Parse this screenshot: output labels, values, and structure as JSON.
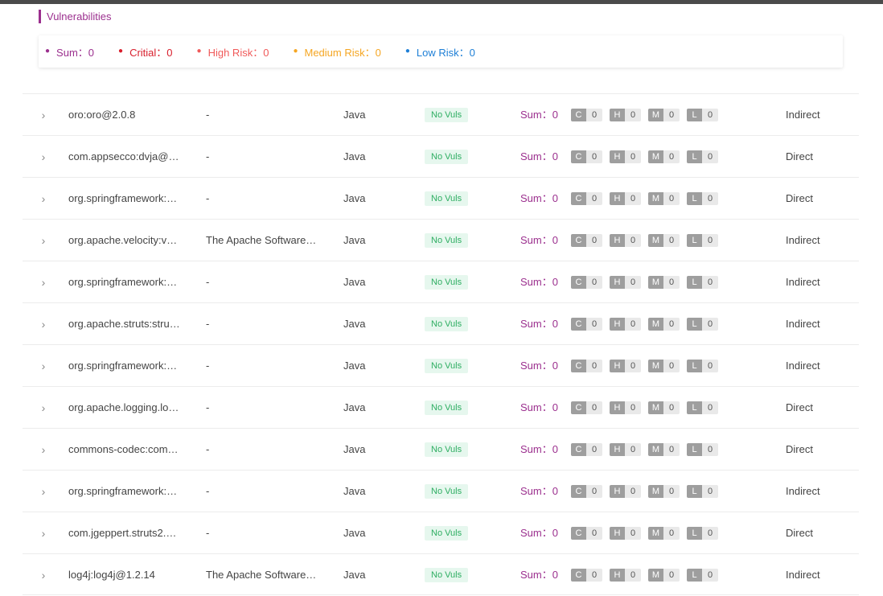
{
  "section_title": "Vulnerabilities",
  "summary": [
    {
      "label": "Sum：0",
      "color": "#9b2f8e"
    },
    {
      "label": "Critial：0",
      "color": "#d81e2c"
    },
    {
      "label": "High Risk：0",
      "color": "#f05a5a"
    },
    {
      "label": "Medium Risk：0",
      "color": "#f5a623"
    },
    {
      "label": "Low Risk：0",
      "color": "#1e7fd6"
    }
  ],
  "level_keys": [
    "C",
    "H",
    "M",
    "L"
  ],
  "rows": [
    {
      "name": "oro:oro@2.0.8",
      "vendor": "-",
      "language": "Java",
      "status": "No Vuls",
      "sum": "Sum：0",
      "counts": [
        "0",
        "0",
        "0",
        "0"
      ],
      "dependency": "Indirect"
    },
    {
      "name": "com.appsecco:dvja@…",
      "vendor": "-",
      "language": "Java",
      "status": "No Vuls",
      "sum": "Sum：0",
      "counts": [
        "0",
        "0",
        "0",
        "0"
      ],
      "dependency": "Direct"
    },
    {
      "name": "org.springframework:…",
      "vendor": "-",
      "language": "Java",
      "status": "No Vuls",
      "sum": "Sum：0",
      "counts": [
        "0",
        "0",
        "0",
        "0"
      ],
      "dependency": "Direct"
    },
    {
      "name": "org.apache.velocity:v…",
      "vendor": "The Apache Software…",
      "language": "Java",
      "status": "No Vuls",
      "sum": "Sum：0",
      "counts": [
        "0",
        "0",
        "0",
        "0"
      ],
      "dependency": "Indirect"
    },
    {
      "name": "org.springframework:…",
      "vendor": "-",
      "language": "Java",
      "status": "No Vuls",
      "sum": "Sum：0",
      "counts": [
        "0",
        "0",
        "0",
        "0"
      ],
      "dependency": "Indirect"
    },
    {
      "name": "org.apache.struts:stru…",
      "vendor": "-",
      "language": "Java",
      "status": "No Vuls",
      "sum": "Sum：0",
      "counts": [
        "0",
        "0",
        "0",
        "0"
      ],
      "dependency": "Indirect"
    },
    {
      "name": "org.springframework:…",
      "vendor": "-",
      "language": "Java",
      "status": "No Vuls",
      "sum": "Sum：0",
      "counts": [
        "0",
        "0",
        "0",
        "0"
      ],
      "dependency": "Indirect"
    },
    {
      "name": "org.apache.logging.lo…",
      "vendor": "-",
      "language": "Java",
      "status": "No Vuls",
      "sum": "Sum：0",
      "counts": [
        "0",
        "0",
        "0",
        "0"
      ],
      "dependency": "Direct"
    },
    {
      "name": "commons-codec:com…",
      "vendor": "-",
      "language": "Java",
      "status": "No Vuls",
      "sum": "Sum：0",
      "counts": [
        "0",
        "0",
        "0",
        "0"
      ],
      "dependency": "Direct"
    },
    {
      "name": "org.springframework:…",
      "vendor": "-",
      "language": "Java",
      "status": "No Vuls",
      "sum": "Sum：0",
      "counts": [
        "0",
        "0",
        "0",
        "0"
      ],
      "dependency": "Indirect"
    },
    {
      "name": "com.jgeppert.struts2.…",
      "vendor": "-",
      "language": "Java",
      "status": "No Vuls",
      "sum": "Sum：0",
      "counts": [
        "0",
        "0",
        "0",
        "0"
      ],
      "dependency": "Direct"
    },
    {
      "name": "log4j:log4j@1.2.14",
      "vendor": "The Apache Software…",
      "language": "Java",
      "status": "No Vuls",
      "sum": "Sum：0",
      "counts": [
        "0",
        "0",
        "0",
        "0"
      ],
      "dependency": "Indirect"
    }
  ]
}
